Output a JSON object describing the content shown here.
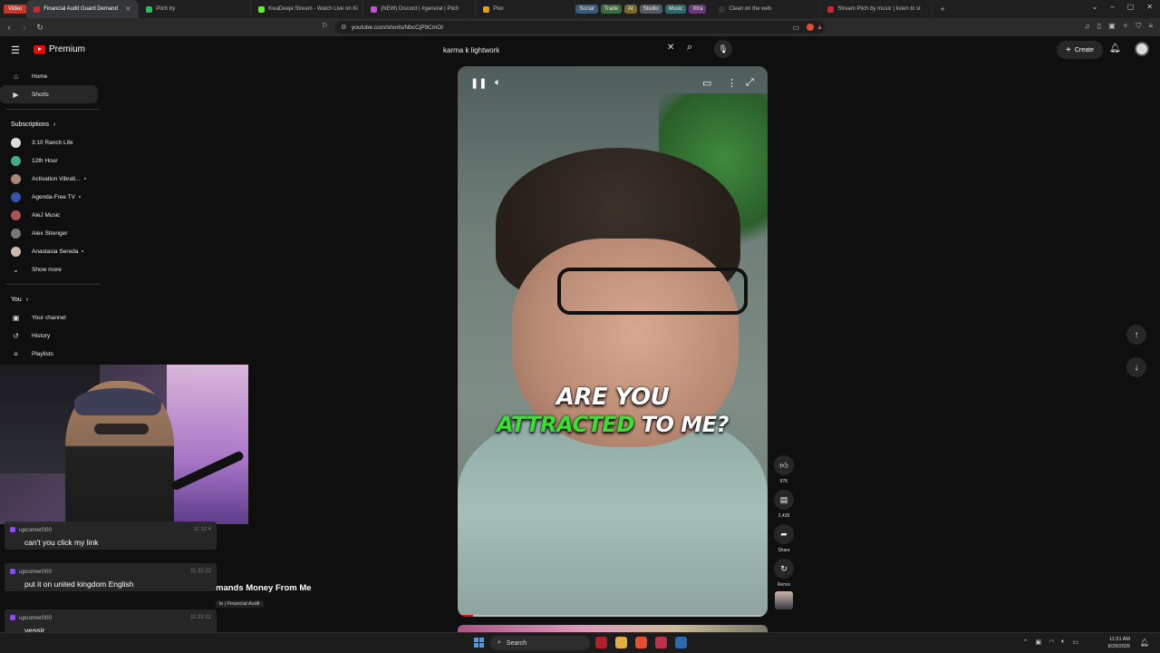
{
  "browser": {
    "video_chip": "Video",
    "tabs": [
      {
        "title": "Financial Audit Guard Demand",
        "color": "#e02020",
        "active": true
      },
      {
        "title": "Pilch by",
        "color": "#20c060",
        "active": false
      },
      {
        "title": "KwaDeeja Stream - Watch Live on Ki",
        "color": "#53fc18",
        "active": false
      },
      {
        "title": "(NEW) Discord | #general | Pilch",
        "color": "#c84be0",
        "active": false
      },
      {
        "title": "Plex",
        "color": "#e5a00d",
        "active": false
      }
    ],
    "groups": [
      {
        "label": "Social",
        "color": "#3a5a7a"
      },
      {
        "label": "Trade",
        "color": "#3d6b3d"
      },
      {
        "label": "AI",
        "color": "#7a6a2a"
      },
      {
        "label": "Studio",
        "color": "#555a66"
      },
      {
        "label": "Music",
        "color": "#2f6a6a"
      },
      {
        "label": "Xtra",
        "color": "#6a3a7a"
      }
    ],
    "extra_tabs": [
      {
        "title": "Clean on the web"
      },
      {
        "title": "Stream Pilch by music | listen to st"
      }
    ],
    "url": "youtube.com/shorts/NbcCjP9CmOl"
  },
  "header": {
    "logo_text": "Premium",
    "search_value": "karma k lightwork",
    "create_label": "Create"
  },
  "sidebar": {
    "home": "Home",
    "shorts": "Shorts",
    "subscriptions_title": "Subscriptions",
    "subscriptions": [
      {
        "name": "3:10 Ranch Life",
        "color": "#ddd",
        "live": false
      },
      {
        "name": "12th Hour",
        "color": "#4a8",
        "live": false
      },
      {
        "name": "Activation Vibrati...",
        "color": "#a87",
        "live": true
      },
      {
        "name": "Agenda-Free TV",
        "color": "#35a",
        "live": true
      },
      {
        "name": "AleJ Music",
        "color": "#a55",
        "live": false
      },
      {
        "name": "Alex Strenger",
        "color": "#777",
        "live": false
      },
      {
        "name": "Anastasia Sereda",
        "color": "#cba",
        "live": true
      }
    ],
    "show_more": "Show more",
    "you_title": "You",
    "you_items": [
      "Your channel",
      "History",
      "Playlists"
    ]
  },
  "chat": [
    {
      "user": "upcomer000",
      "time": "11:32:4",
      "text": "can't you click my link"
    },
    {
      "user": "upcomer000",
      "time": "11:32:22",
      "text": "put it on united kingdom English"
    },
    {
      "user": "upcomer000",
      "time": "11:33:22",
      "text": "yessir"
    }
  ],
  "background_video": {
    "title": "mands Money From Me",
    "channel": "le | Financial Audit"
  },
  "player": {
    "caption_line1": "ARE YOU",
    "caption_word_green": "ATTRACTED",
    "caption_rest": "TO ME?",
    "progress": 0.05
  },
  "actions": {
    "likes": "97K",
    "comments": "2,438",
    "share": "Share",
    "remix": "Remix"
  },
  "taskbar": {
    "search_label": "Search",
    "time": "11:51 AM",
    "date": "8/29/2026"
  }
}
